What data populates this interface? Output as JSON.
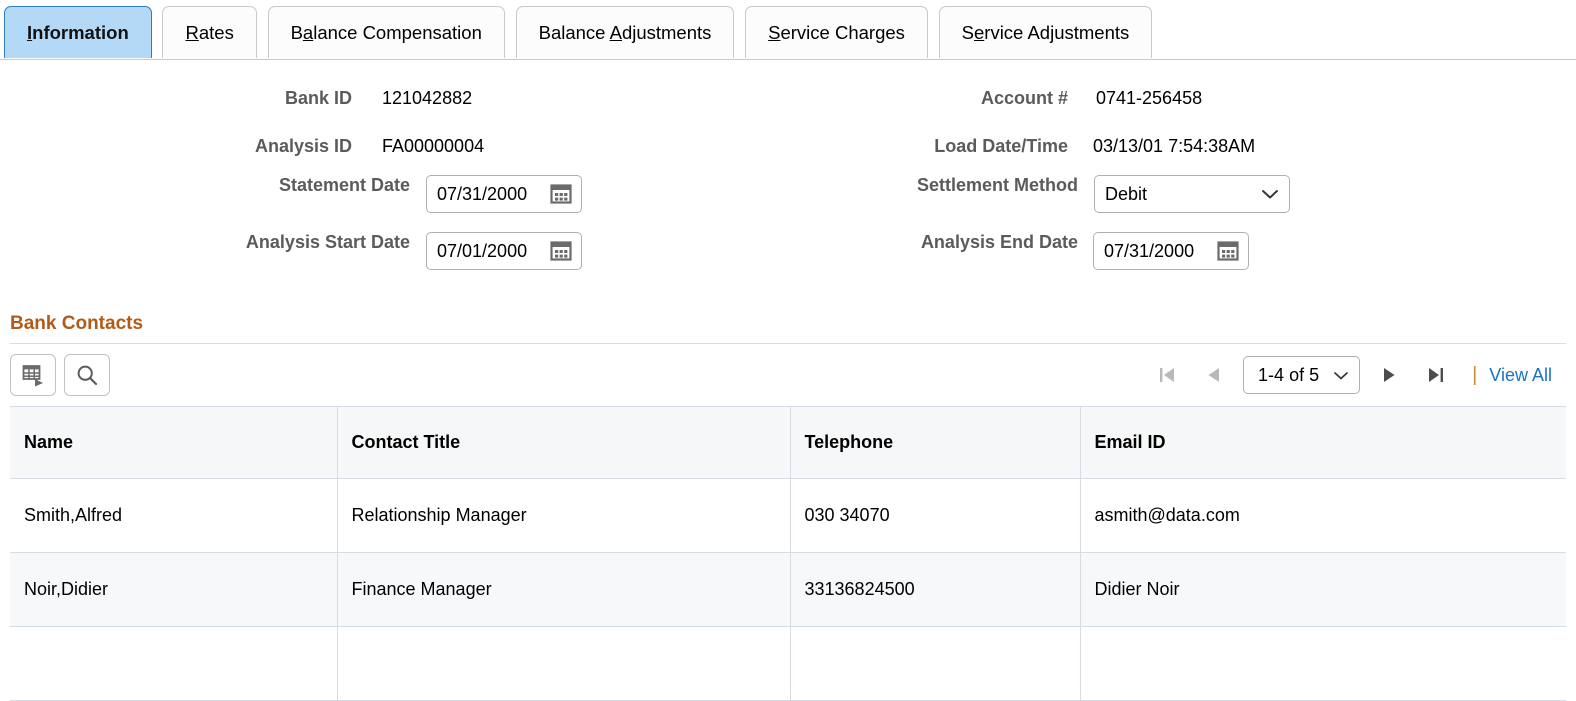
{
  "tabs": [
    {
      "label": "Information",
      "accesskey": "I",
      "active": true
    },
    {
      "label": "Rates",
      "accesskey": "R",
      "active": false
    },
    {
      "label": "Balance Compensation",
      "accesskey": "B",
      "active": false
    },
    {
      "label": "Balance Adjustments",
      "accesskey": "A",
      "active": false
    },
    {
      "label": "Service Charges",
      "accesskey": "S",
      "active": false
    },
    {
      "label": "Service Adjustments",
      "accesskey": "e",
      "active": false
    }
  ],
  "form": {
    "bank_id_label": "Bank ID",
    "bank_id_value": "121042882",
    "analysis_id_label": "Analysis ID",
    "analysis_id_value": "FA00000004",
    "statement_date_label": "Statement Date",
    "statement_date_value": "07/31/2000",
    "analysis_start_date_label": "Analysis Start Date",
    "analysis_start_date_value": "07/01/2000",
    "account_label": "Account #",
    "account_value": "0741-256458",
    "load_datetime_label": "Load Date/Time",
    "load_datetime_value": "03/13/01  7:54:38AM",
    "settlement_method_label": "Settlement Method",
    "settlement_method_value": "Debit",
    "analysis_end_date_label": "Analysis End Date",
    "analysis_end_date_value": "07/31/2000"
  },
  "bank_contacts": {
    "title": "Bank Contacts",
    "pager": {
      "range": "1-4 of 5",
      "view_all": "View All"
    },
    "columns": [
      "Name",
      "Contact Title",
      "Telephone",
      "Email ID"
    ],
    "rows": [
      {
        "name": "Smith,Alfred",
        "contact_title": "Relationship Manager",
        "telephone": "030 34070",
        "email": "asmith@data.com"
      },
      {
        "name": "Noir,Didier",
        "contact_title": "Finance Manager",
        "telephone": "33136824500",
        "email": "Didier Noir"
      },
      {
        "name": "",
        "contact_title": "",
        "telephone": "",
        "email": ""
      }
    ]
  },
  "colors": {
    "active_tab_bg": "#b4d9f7",
    "active_tab_border": "#2d7dc4",
    "section_title": "#b35a17",
    "link": "#1a73c8",
    "label": "#5b5b5b",
    "grid_border": "#d6dce3",
    "header_bg": "#f6f7f8",
    "alt_row_bg": "#f7f8f9"
  }
}
